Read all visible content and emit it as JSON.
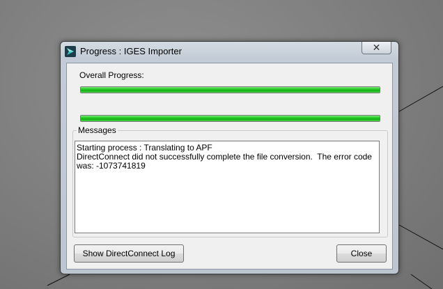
{
  "window": {
    "title": "Progress : IGES Importer",
    "close_label": "✕",
    "icon": "app-logo-icon"
  },
  "progress": {
    "overall_label": "Overall Progress:",
    "overall_fraction": 1.0,
    "secondary_fraction": 1.0,
    "bar_color": "#22c822"
  },
  "messages": {
    "group_label": "Messages",
    "lines": [
      "Starting process : Translating to APF",
      "DirectConnect did not successfully complete the file conversion.  The error code was: -1073741819"
    ]
  },
  "buttons": {
    "show_log": "Show DirectConnect Log",
    "close": "Close"
  }
}
